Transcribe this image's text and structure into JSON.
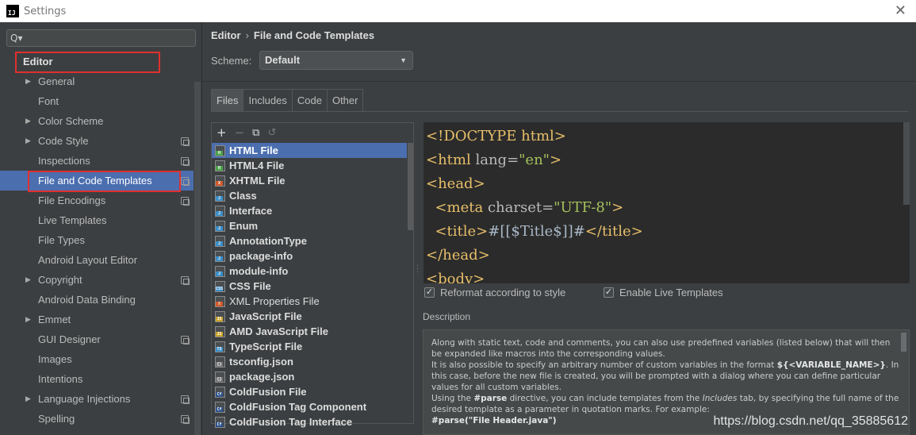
{
  "window": {
    "title": "Settings",
    "app_icon_text": "IJ"
  },
  "search": {
    "placeholder": "",
    "value": "",
    "glyph": "Q▾"
  },
  "sidebar": {
    "items": [
      {
        "label": "Editor",
        "root": true,
        "arrow": false,
        "copy": false
      },
      {
        "label": "General",
        "arrow": true,
        "copy": false
      },
      {
        "label": "Font",
        "arrow": false,
        "copy": false
      },
      {
        "label": "Color Scheme",
        "arrow": true,
        "copy": false
      },
      {
        "label": "Code Style",
        "arrow": true,
        "copy": true
      },
      {
        "label": "Inspections",
        "arrow": false,
        "copy": true
      },
      {
        "label": "File and Code Templates",
        "arrow": false,
        "copy": true,
        "selected": true
      },
      {
        "label": "File Encodings",
        "arrow": false,
        "copy": true
      },
      {
        "label": "Live Templates",
        "arrow": false,
        "copy": false
      },
      {
        "label": "File Types",
        "arrow": false,
        "copy": false
      },
      {
        "label": "Android Layout Editor",
        "arrow": false,
        "copy": false
      },
      {
        "label": "Copyright",
        "arrow": true,
        "copy": true
      },
      {
        "label": "Android Data Binding",
        "arrow": false,
        "copy": false
      },
      {
        "label": "Emmet",
        "arrow": true,
        "copy": false
      },
      {
        "label": "GUI Designer",
        "arrow": false,
        "copy": true
      },
      {
        "label": "Images",
        "arrow": false,
        "copy": false
      },
      {
        "label": "Intentions",
        "arrow": false,
        "copy": false
      },
      {
        "label": "Language Injections",
        "arrow": true,
        "copy": true
      },
      {
        "label": "Spelling",
        "arrow": false,
        "copy": true
      }
    ]
  },
  "breadcrumb": {
    "parent": "Editor",
    "separator": "›",
    "current": "File and Code Templates"
  },
  "scheme": {
    "label": "Scheme:",
    "value": "Default"
  },
  "tabs": [
    {
      "label": "Files",
      "active": true
    },
    {
      "label": "Includes"
    },
    {
      "label": "Code"
    },
    {
      "label": "Other"
    }
  ],
  "file_toolbar": {
    "add": "+",
    "remove": "−",
    "copy": "⧉",
    "reset": "↺"
  },
  "files": [
    {
      "label": "HTML File",
      "tag": "H",
      "color": "#4aa14a",
      "selected": true
    },
    {
      "label": "HTML4 File",
      "tag": "H",
      "color": "#4aa14a"
    },
    {
      "label": "XHTML File",
      "tag": "X",
      "color": "#d05a2a"
    },
    {
      "label": "Class",
      "tag": "J",
      "color": "#3b8ec7"
    },
    {
      "label": "Interface",
      "tag": "J",
      "color": "#3b8ec7"
    },
    {
      "label": "Enum",
      "tag": "J",
      "color": "#3b8ec7"
    },
    {
      "label": "AnnotationType",
      "tag": "J",
      "color": "#3b8ec7"
    },
    {
      "label": "package-info",
      "tag": "J",
      "color": "#3b8ec7"
    },
    {
      "label": "module-info",
      "tag": "J",
      "color": "#3b8ec7"
    },
    {
      "label": "CSS File",
      "tag": "CSS",
      "color": "#3b8ec7"
    },
    {
      "label": "XML Properties File",
      "tag": "X",
      "color": "#d05a2a",
      "normal": true
    },
    {
      "label": "JavaScript File",
      "tag": "JS",
      "color": "#c9a227"
    },
    {
      "label": "AMD JavaScript File",
      "tag": "JS",
      "color": "#c9a227"
    },
    {
      "label": "TypeScript File",
      "tag": "TS",
      "color": "#3b8ec7"
    },
    {
      "label": "tsconfig.json",
      "tag": "{}",
      "color": "#777777"
    },
    {
      "label": "package.json",
      "tag": "{}",
      "color": "#777777"
    },
    {
      "label": "ColdFusion File",
      "tag": "Cf",
      "color": "#2a4f8a"
    },
    {
      "label": "ColdFusion Tag Component",
      "tag": "Cf",
      "color": "#2a4f8a"
    },
    {
      "label": "ColdFusion Tag Interface",
      "tag": "Cf",
      "color": "#2a4f8a"
    }
  ],
  "editor": {
    "lines": [
      {
        "indent": "",
        "parts": [
          [
            "tag",
            "<!DOCTYPE html>"
          ]
        ]
      },
      {
        "indent": "",
        "parts": [
          [
            "tag",
            "<html "
          ],
          [
            "attr",
            "lang="
          ],
          [
            "val",
            "\"en\""
          ],
          [
            "tag",
            ">"
          ]
        ]
      },
      {
        "indent": "",
        "parts": [
          [
            "tag",
            "<head>"
          ]
        ]
      },
      {
        "indent": "  ",
        "parts": [
          [
            "tag",
            "<meta "
          ],
          [
            "attr",
            "charset="
          ],
          [
            "val",
            "\"UTF-8\""
          ],
          [
            "tag",
            ">"
          ]
        ]
      },
      {
        "indent": "  ",
        "parts": [
          [
            "tag",
            "<title>"
          ],
          [
            "txt",
            "#[[$Title$]]#"
          ],
          [
            "tag",
            "</title>"
          ]
        ]
      },
      {
        "indent": "",
        "parts": [
          [
            "tag",
            "</head>"
          ]
        ]
      },
      {
        "indent": "",
        "parts": [
          [
            "tag",
            "<body>"
          ]
        ]
      }
    ]
  },
  "options": {
    "reformat": {
      "label": "Reformat according to style",
      "checked": true
    },
    "live_templates": {
      "label": "Enable Live Templates",
      "checked": true
    }
  },
  "description": {
    "label": "Description",
    "p1": "Along with static text, code and comments, you can also use predefined variables (listed below) that will then be expanded like macros into the corresponding values.",
    "p2a": "It is also possible to specify an arbitrary number of custom variables in the format ",
    "p2b": "${<VARIABLE_NAME>}",
    "p2c": ". In this case, before the new file is created, you will be prompted with a dialog where you can define particular values for all custom variables.",
    "p3a": "Using the ",
    "p3b": "#parse",
    "p3c": " directive, you can include templates from the ",
    "p3d": "Includes",
    "p3e": " tab, by specifying the full name of the desired template as a parameter in quotation marks. For example:",
    "p4": "#parse(\"File Header.java\")"
  },
  "watermark": "https://blog.csdn.net/qq_35885612"
}
